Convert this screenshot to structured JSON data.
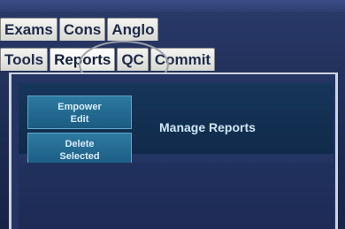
{
  "tabs_row1": [
    "Exams",
    "Cons",
    "Anglo"
  ],
  "tabs_row2": [
    "Tools",
    "Reports",
    "QC",
    "Commit"
  ],
  "active_tab": "Reports",
  "buttons": {
    "btn1": "Empower\nEdit",
    "btn2": "Delete\nSelected"
  },
  "manage_reports": "Manage Reports"
}
